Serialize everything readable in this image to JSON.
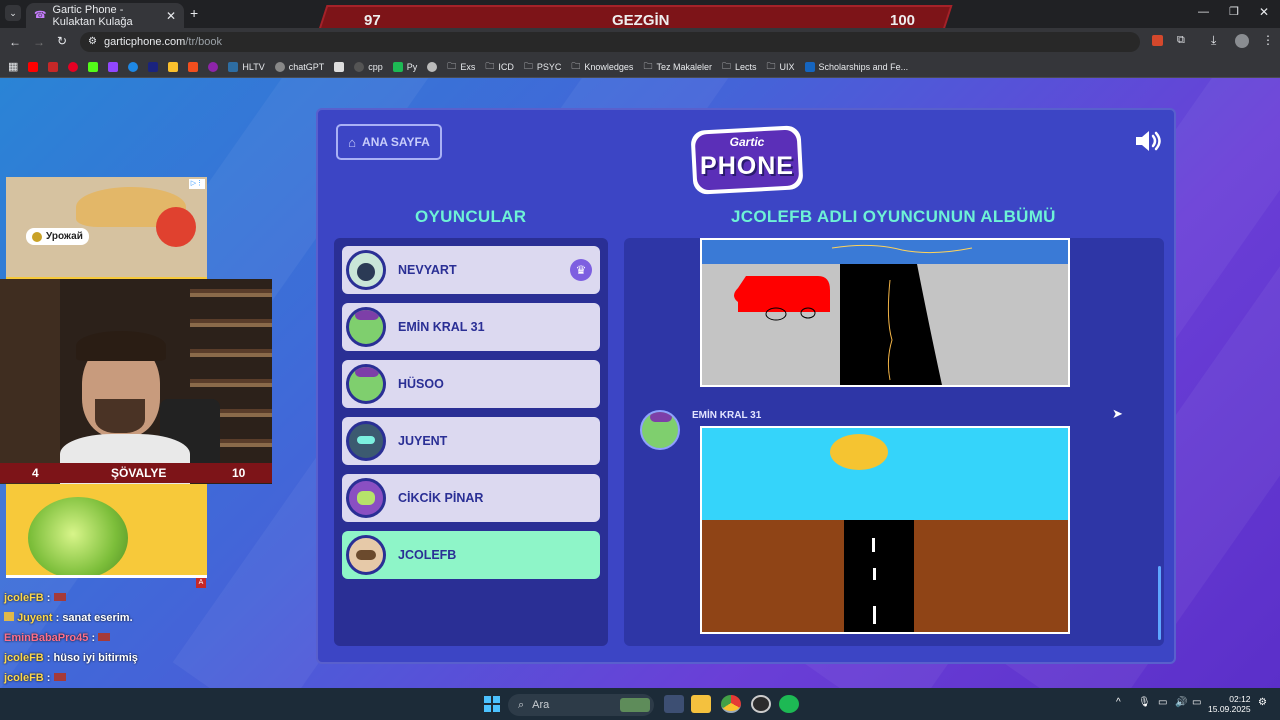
{
  "browser": {
    "tab_title": "Gartic Phone - Kulaktan Kulağa",
    "url_domain": "garticphone.com",
    "url_path": "/tr/book",
    "bookmarks": [
      "HLTV",
      "chatGPT",
      "cpp",
      "Py",
      "Exs",
      "ICD",
      "PSYC",
      "Knowledges",
      "Tez Makaleler",
      "Lects",
      "UIX",
      "Scholarships and Fe..."
    ]
  },
  "scoreboard": {
    "left_score": "97",
    "title": "GEZGİN",
    "right_score": "100"
  },
  "game": {
    "home_label": "ANA SAYFA",
    "logo_top": "Gartic",
    "logo_bottom": "PHONE",
    "players_title": "OYUNCULAR",
    "album_title": "JCOLEFB ADLI OYUNCUNUN ALBÜMÜ",
    "players": [
      {
        "name": "NEVYART",
        "host": true,
        "active": false
      },
      {
        "name": "EMİN KRAL 31",
        "host": false,
        "active": false
      },
      {
        "name": "HÜSOO",
        "host": false,
        "active": false
      },
      {
        "name": "JUYENT",
        "host": false,
        "active": false
      },
      {
        "name": "CİKCİK PİNAR",
        "host": false,
        "active": false
      },
      {
        "name": "JCOLEFB",
        "host": false,
        "active": true
      }
    ],
    "album_author": "EMİN KRAL 31"
  },
  "stream": {
    "ad_label": "Урожай",
    "cam_left": "4",
    "cam_title": "ŞÖVALYE",
    "cam_right": "10",
    "chat": [
      {
        "user": "jcoleFB",
        "msg": ":",
        "user_color": "#ffd84a"
      },
      {
        "user": "Juyent",
        "msg": ": sanat eserim.",
        "user_color": "#ffd84a"
      },
      {
        "user": "EminBabaPro45",
        "msg": ":",
        "user_color": "#ff6f8a"
      },
      {
        "user": "jcoleFB",
        "msg": ": hüso iyi bitirmiş",
        "user_color": "#ffd84a"
      },
      {
        "user": "jcoleFB",
        "msg": ":",
        "user_color": "#ffd84a"
      }
    ]
  },
  "taskbar": {
    "search_placeholder": "Ara",
    "time": "02:12",
    "date": "15.09.2025"
  }
}
